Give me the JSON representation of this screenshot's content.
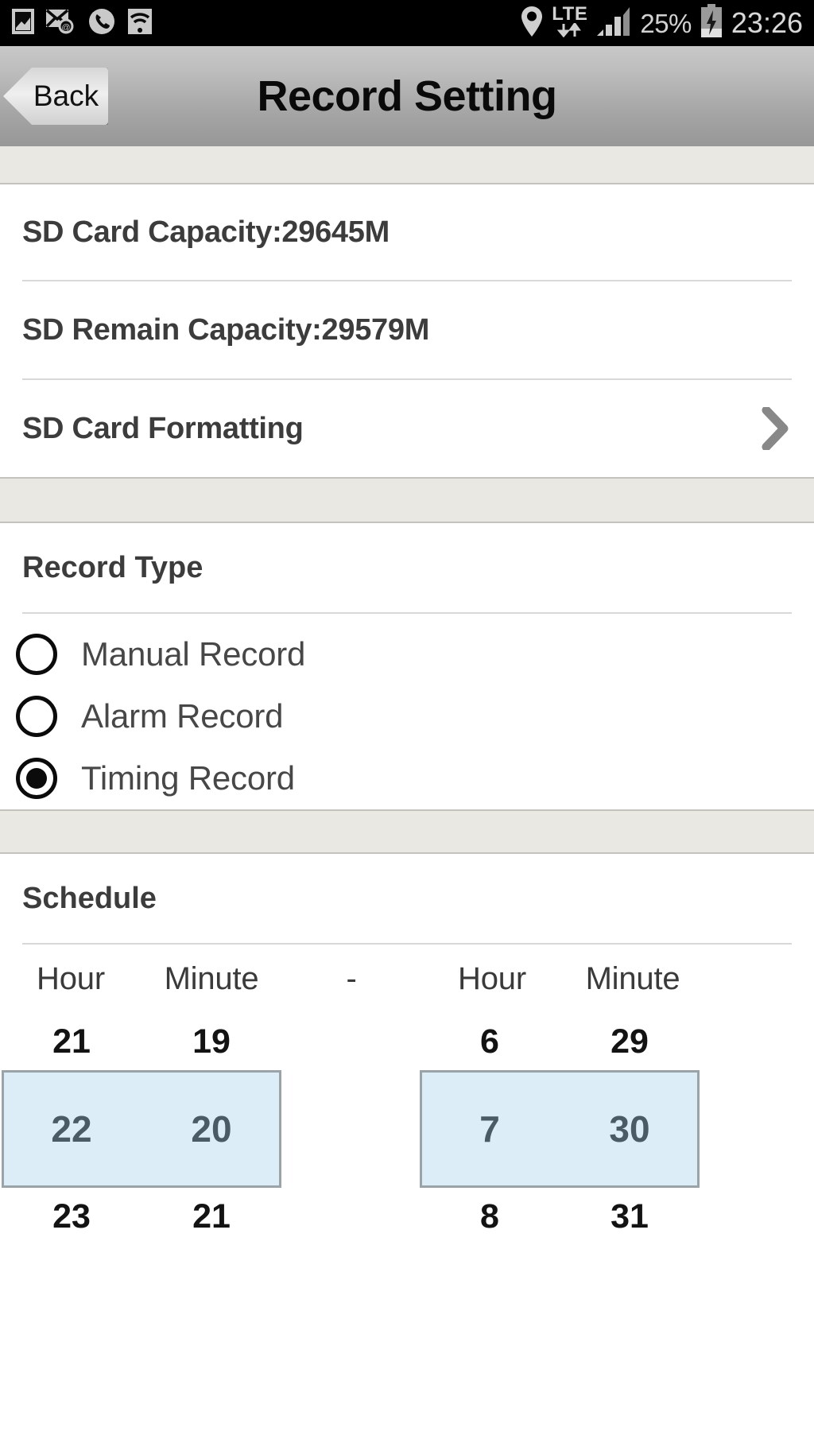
{
  "status_bar": {
    "icons_left": [
      "photo-icon",
      "mail-sync-icon",
      "phone-icon",
      "wifi-icon"
    ],
    "location_icon": "location-pin-icon",
    "network_label": "LTE",
    "network_arrows_icon": "data-transfer-arrows-icon",
    "signal_icon": "signal-bars-icon",
    "battery_percent": "25%",
    "battery_icon": "battery-charging-icon",
    "clock": "23:26"
  },
  "title_bar": {
    "back_label": "Back",
    "title": "Record Setting"
  },
  "sd_section": {
    "capacity_row": "SD Card Capacity:29645M",
    "remain_row": "SD Remain Capacity:29579M",
    "formatting_row": "SD Card Formatting",
    "formatting_chevron_icon": "chevron-right-icon"
  },
  "record_type": {
    "heading": "Record Type",
    "options": [
      {
        "label": "Manual Record",
        "selected": false
      },
      {
        "label": "Alarm Record",
        "selected": false
      },
      {
        "label": "Timing Record",
        "selected": true
      }
    ]
  },
  "schedule": {
    "heading": "Schedule",
    "headers": {
      "start_hour": "Hour",
      "start_minute": "Minute",
      "separator": "-",
      "end_hour": "Hour",
      "end_minute": "Minute"
    },
    "columns": {
      "start_hour": {
        "above": "21",
        "selected": "22",
        "below": "23"
      },
      "start_minute": {
        "above": "19",
        "selected": "20",
        "below": "21"
      },
      "end_hour": {
        "above": "6",
        "selected": "7",
        "below": "8"
      },
      "end_minute": {
        "above": "29",
        "selected": "30",
        "below": "31"
      }
    }
  },
  "colors": {
    "selection_fill": "#dcedf8",
    "selection_border": "#9aa4a8",
    "selected_text": "#4b5b66",
    "spacer_band": "#eae8e3",
    "title_bar_top": "#c8c8c8",
    "title_bar_bottom": "#979797"
  }
}
